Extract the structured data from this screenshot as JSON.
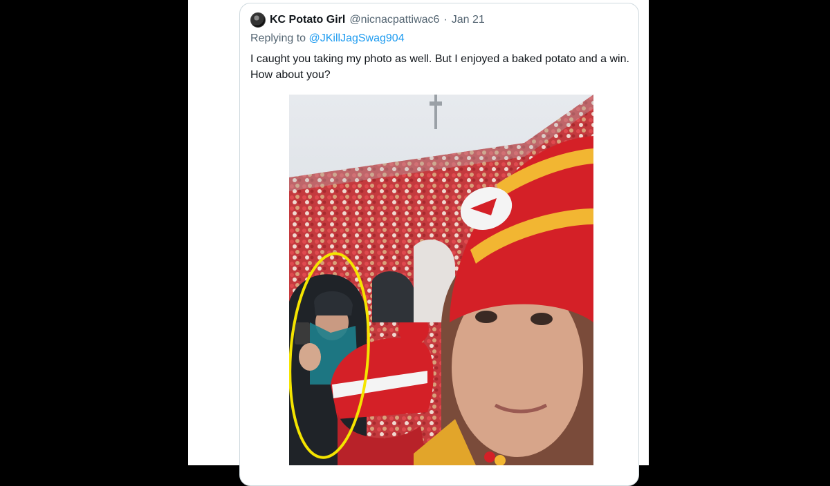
{
  "tweet": {
    "display_name": "KC Potato Girl",
    "handle": "@nicnacpattiwac6",
    "separator": "·",
    "date": "Jan 21",
    "reply_prefix": "Replying to",
    "reply_to": "@JKillJagSwag904",
    "text": "I caught you taking my photo as well.  But I enjoyed a baked potato and a win.  How about you?"
  },
  "icons": {
    "avatar": "user-avatar-icon"
  },
  "colors": {
    "handle_gray": "#536471",
    "mention_blue": "#1d9bf0",
    "highlight_circle": "#f4e400",
    "chiefs_red": "#d42027",
    "chiefs_gold": "#f2b632"
  }
}
